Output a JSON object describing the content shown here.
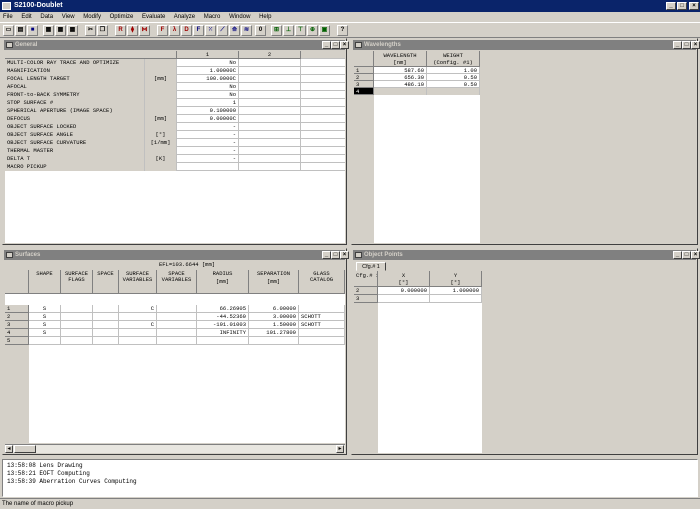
{
  "app": {
    "title": "S2100-Doublet"
  },
  "menu": [
    "File",
    "Edit",
    "Data",
    "View",
    "Modify",
    "Optimize",
    "Evaluate",
    "Analyze",
    "Macro",
    "Window",
    "Help"
  ],
  "general": {
    "title": "General",
    "col1": "1",
    "col2": "2",
    "rows": [
      {
        "label": "MULTI-COLOR RAY TRACE AND OPTIMIZE",
        "unit": "",
        "v1": "No"
      },
      {
        "label": "MAGNIFICATION",
        "unit": "",
        "v1": "1.00000C"
      },
      {
        "label": "FOCAL LENGTH TARGET",
        "unit": "[mm]",
        "v1": "100.0000C"
      },
      {
        "label": "AFOCAL",
        "unit": "",
        "v1": "No"
      },
      {
        "label": "FRONT-to-BACK SYMMETRY",
        "unit": "",
        "v1": "No"
      },
      {
        "label": "STOP SURFACE #",
        "unit": "",
        "v1": "1"
      },
      {
        "label": "SPHERICAL APERTURE (IMAGE SPACE)",
        "unit": "",
        "v1": "0.100000"
      },
      {
        "label": "DEFOCUS",
        "unit": "[mm]",
        "v1": "0.00000C"
      },
      {
        "label": "OBJECT SURFACE LOCKED",
        "unit": "",
        "v1": "-"
      },
      {
        "label": "OBJECT SURFACE ANGLE",
        "unit": "[°]",
        "v1": "-"
      },
      {
        "label": "OBJECT SURFACE CURVATURE",
        "unit": "[1/mm]",
        "v1": "-"
      },
      {
        "label": "THERMAL MASTER",
        "unit": "",
        "v1": "-"
      },
      {
        "label": "DELTA T",
        "unit": "[K]",
        "v1": "-"
      },
      {
        "label": "MACRO PICKUP",
        "unit": "",
        "v1": ""
      }
    ]
  },
  "wavelengths": {
    "title": "Wavelengths",
    "h1": "WAVELENGTH",
    "h1b": "[nm]",
    "h2": "WEIGHT",
    "h2b": "(Config. #1)",
    "rows": [
      {
        "n": "1",
        "wl": "587.60",
        "w": "1.00"
      },
      {
        "n": "2",
        "wl": "656.30",
        "w": "0.50"
      },
      {
        "n": "3",
        "wl": "486.10",
        "w": "0.50"
      },
      {
        "n": "4",
        "wl": "",
        "w": ""
      }
    ]
  },
  "surfaces": {
    "title": "Surfaces",
    "efl": "EFL=103.6644 [mm]",
    "headers": [
      "SHAPE",
      "SURFACE FLAGS",
      "SPACE",
      "SURFACE VARIABLES",
      "SPACE VARIABLES",
      "RADIUS",
      "SEPARATION",
      "GLASS CATALOG"
    ],
    "units": [
      "",
      "",
      "",
      "",
      "",
      "[mm]",
      "[mm]",
      ""
    ],
    "rows": [
      {
        "n": "1",
        "shape": "S",
        "var": "C",
        "radius": "66.26905",
        "sep": "6.00000",
        "glass": ""
      },
      {
        "n": "2",
        "shape": "S",
        "var": "",
        "radius": "-44.52360",
        "sep": "3.00000",
        "glass": "SCHOTT"
      },
      {
        "n": "3",
        "shape": "S",
        "var": "C",
        "radius": "-191.01003",
        "sep": "1.50000",
        "glass": "SCHOTT"
      },
      {
        "n": "4",
        "shape": "S",
        "var": "",
        "radius": "INFINITY",
        "sep": "101.27800",
        "glass": ""
      },
      {
        "n": "5",
        "shape": "",
        "var": "",
        "radius": "",
        "sep": "",
        "glass": ""
      }
    ]
  },
  "object_points": {
    "title": "Object Points",
    "tab": "Cfg.# 1",
    "corner": "Cfg.# 1",
    "hx": "X",
    "hxu": "[°]",
    "hy": "Y",
    "hyu": "[°]",
    "rows": [
      {
        "n": "2",
        "x": "0.000000",
        "y": "1.000000"
      },
      {
        "n": "3",
        "x": "",
        "y": ""
      }
    ]
  },
  "log": [
    "13:58:08  Lens Drawing",
    "13:58:21  EOFT Computing",
    "13:58:39  Aberration Curves Computing"
  ],
  "status": "The name of macro pickup"
}
